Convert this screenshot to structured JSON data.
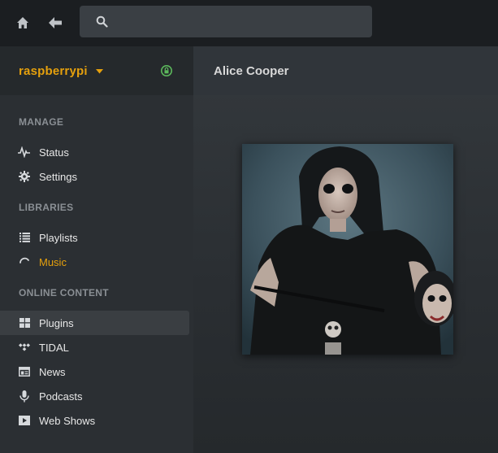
{
  "topbar": {
    "home_icon": "home-icon",
    "back_icon": "back-arrow-icon",
    "search": {
      "placeholder": "",
      "icon": "search-icon"
    }
  },
  "sidebar": {
    "server": {
      "name": "raspberrypi",
      "caret_icon": "caret-down-icon",
      "lock_icon": "lock-icon",
      "lock_color": "#5cb85c"
    },
    "sections": [
      {
        "title": "MANAGE"
      },
      {
        "title": "LIBRARIES"
      },
      {
        "title": "ONLINE CONTENT"
      }
    ],
    "items": [
      {
        "label": "Status",
        "icon": "activity-icon"
      },
      {
        "label": "Settings",
        "icon": "gear-icon"
      },
      {
        "label": "Playlists",
        "icon": "list-icon"
      },
      {
        "label": "Music",
        "icon": "loading-spinner-icon",
        "active": true
      },
      {
        "label": "Plugins",
        "icon": "grid-icon",
        "selected": true
      },
      {
        "label": "TIDAL",
        "icon": "tidal-icon"
      },
      {
        "label": "News",
        "icon": "newspaper-icon"
      },
      {
        "label": "Podcasts",
        "icon": "microphone-icon"
      },
      {
        "label": "Web Shows",
        "icon": "play-square-icon"
      }
    ]
  },
  "main": {
    "title": "Alice Cooper",
    "artwork": "artist-photo"
  },
  "colors": {
    "accent": "#e5a00d",
    "sidebar_bg": "#2b2f33",
    "topbar_bg": "#1b1e21"
  }
}
